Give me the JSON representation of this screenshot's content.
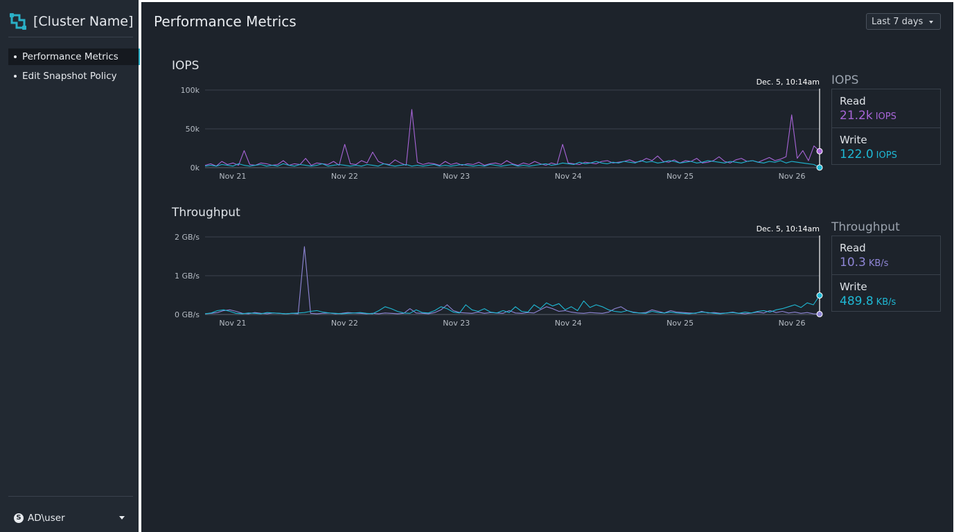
{
  "sidebar": {
    "cluster_name": "[Cluster Name]",
    "nav_items": [
      "Performance Metrics",
      "Edit Snapshot Policy"
    ],
    "active_item": "Performance Metrics",
    "user": {
      "icon_letter": "S",
      "name": "AD\\user"
    }
  },
  "main": {
    "title": "Performance Metrics",
    "time_range": "Last 7 days"
  },
  "colors": {
    "read": "#a865d8",
    "write": "#1fb8d4",
    "throughput_read": "#8f86d6",
    "accent": "#2ab0c7"
  },
  "chart_data": [
    {
      "type": "line",
      "title": "IOPS",
      "x_labels": [
        "Nov 21",
        "Nov 22",
        "Nov 23",
        "Nov 24",
        "Nov 25",
        "Nov 26"
      ],
      "y_ticks": [
        "100k",
        "50k",
        "0k"
      ],
      "ylim": [
        0,
        100000
      ],
      "marker_label": "Dec. 5, 10:14am",
      "series": [
        {
          "name": "Read",
          "values": [
            3000,
            5000,
            2000,
            8000,
            4000,
            6000,
            3000,
            22000,
            4000,
            3000,
            6000,
            5000,
            3000,
            4000,
            9000,
            3000,
            5000,
            4000,
            12000,
            3000,
            6000,
            5000,
            4000,
            8000,
            3000,
            30000,
            5000,
            4000,
            9000,
            6000,
            20000,
            8000,
            5000,
            4000,
            10000,
            6000,
            3000,
            75000,
            7000,
            4000,
            6000,
            5000,
            3000,
            8000,
            4000,
            6000,
            3000,
            5000,
            4000,
            7000,
            3000,
            5000,
            6000,
            4000,
            9000,
            5000,
            3000,
            6000,
            4000,
            8000,
            5000,
            3000,
            6000,
            4000,
            30000,
            6000,
            5000,
            4000,
            7000,
            6000,
            5000,
            8000,
            9000,
            6000,
            7000,
            8000,
            10000,
            7000,
            8000,
            12000,
            9000,
            15000,
            8000,
            7000,
            10000,
            6000,
            9000,
            8000,
            12000,
            6000,
            7000,
            9000,
            14000,
            8000,
            6000,
            10000,
            12000,
            8000,
            9000,
            7000,
            10000,
            13000,
            9000,
            11000,
            14000,
            68000,
            12000,
            22000,
            9000,
            28000,
            21200
          ]
        },
        {
          "name": "Write",
          "values": [
            2000,
            3000,
            2000,
            4000,
            3000,
            2000,
            5000,
            3000,
            2000,
            3000,
            4000,
            2000,
            3000,
            2000,
            5000,
            3000,
            2000,
            4000,
            3000,
            2000,
            3000,
            5000,
            2000,
            3000,
            4000,
            3000,
            2000,
            3000,
            2000,
            4000,
            3000,
            2000,
            5000,
            3000,
            2000,
            3000,
            4000,
            2000,
            3000,
            2000,
            3000,
            4000,
            2000,
            3000,
            2000,
            3000,
            4000,
            3000,
            2000,
            3000,
            2000,
            4000,
            3000,
            2000,
            3000,
            4000,
            2000,
            3000,
            2000,
            3000,
            4000,
            5000,
            3000,
            4000,
            6000,
            5000,
            4000,
            7000,
            5000,
            6000,
            8000,
            6000,
            5000,
            7000,
            6000,
            8000,
            7000,
            6000,
            9000,
            7000,
            8000,
            6000,
            7000,
            9000,
            8000,
            6000,
            7000,
            8000,
            6000,
            7000,
            9000,
            8000,
            7000,
            6000,
            8000,
            7000,
            6000,
            8000,
            9000,
            7000,
            6000,
            8000,
            7000,
            9000,
            6000,
            8000,
            7000,
            6000,
            5000,
            4000,
            122
          ]
        }
      ],
      "legend": {
        "title": "IOPS",
        "read_label": "Read",
        "read_value": "21.2k",
        "read_unit": "IOPS",
        "write_label": "Write",
        "write_value": "122.0",
        "write_unit": "IOPS"
      }
    },
    {
      "type": "line",
      "title": "Throughput",
      "x_labels": [
        "Nov 21",
        "Nov 22",
        "Nov 23",
        "Nov 24",
        "Nov 25",
        "Nov 26"
      ],
      "y_ticks": [
        "2 GB/s",
        "1 GB/s",
        "0 GB/s"
      ],
      "ylim": [
        0,
        2
      ],
      "marker_label": "Dec. 5, 10:14am",
      "series": [
        {
          "name": "Read",
          "values": [
            0.02,
            0.03,
            0.05,
            0.1,
            0.12,
            0.08,
            0.03,
            0.02,
            0.05,
            0.03,
            0.02,
            0.04,
            0.03,
            0.02,
            0.03,
            0.02,
            1.75,
            0.03,
            0.02,
            0.03,
            0.04,
            0.02,
            0.03,
            0.05,
            0.04,
            0.03,
            0.02,
            0.03,
            0.02,
            0.04,
            0.03,
            0.02,
            0.03,
            0.15,
            0.04,
            0.03,
            0.02,
            0.05,
            0.12,
            0.25,
            0.1,
            0.05,
            0.04,
            0.03,
            0.06,
            0.03,
            0.05,
            0.04,
            0.03,
            0.1,
            0.04,
            0.03,
            0.05,
            0.04,
            0.12,
            0.2,
            0.15,
            0.08,
            0.1,
            0.06,
            0.04,
            0.03,
            0.05,
            0.04,
            0.03,
            0.06,
            0.15,
            0.2,
            0.1,
            0.06,
            0.04,
            0.05,
            0.12,
            0.08,
            0.04,
            0.1,
            0.06,
            0.05,
            0.04,
            0.03,
            0.08,
            0.04,
            0.05,
            0.03,
            0.04,
            0.06,
            0.03,
            0.02,
            0.04,
            0.06,
            0.04,
            0.1,
            0.05,
            0.08,
            0.04,
            0.06,
            0.03,
            0.05,
            0.02,
            0.0103
          ]
        },
        {
          "name": "Write",
          "values": [
            0.02,
            0.04,
            0.1,
            0.12,
            0.08,
            0.03,
            0.02,
            0.04,
            0.03,
            0.02,
            0.05,
            0.04,
            0.03,
            0.02,
            0.03,
            0.04,
            0.05,
            0.08,
            0.1,
            0.06,
            0.04,
            0.03,
            0.02,
            0.03,
            0.04,
            0.05,
            0.03,
            0.02,
            0.1,
            0.2,
            0.15,
            0.08,
            0.04,
            0.03,
            0.12,
            0.05,
            0.04,
            0.1,
            0.2,
            0.15,
            0.06,
            0.04,
            0.25,
            0.12,
            0.08,
            0.15,
            0.06,
            0.04,
            0.1,
            0.05,
            0.2,
            0.08,
            0.06,
            0.25,
            0.15,
            0.3,
            0.22,
            0.28,
            0.12,
            0.2,
            0.1,
            0.35,
            0.18,
            0.25,
            0.2,
            0.12,
            0.08,
            0.06,
            0.1,
            0.05,
            0.04,
            0.03,
            0.08,
            0.05,
            0.04,
            0.06,
            0.04,
            0.03,
            0.02,
            0.04,
            0.06,
            0.05,
            0.03,
            0.02,
            0.04,
            0.05,
            0.03,
            0.06,
            0.04,
            0.08,
            0.1,
            0.06,
            0.12,
            0.15,
            0.2,
            0.25,
            0.18,
            0.3,
            0.25,
            0.49
          ]
        }
      ],
      "legend": {
        "title": "Throughput",
        "read_label": "Read",
        "read_value": "10.3",
        "read_unit": "KB/s",
        "write_label": "Write",
        "write_value": "489.8",
        "write_unit": "KB/s"
      }
    }
  ]
}
